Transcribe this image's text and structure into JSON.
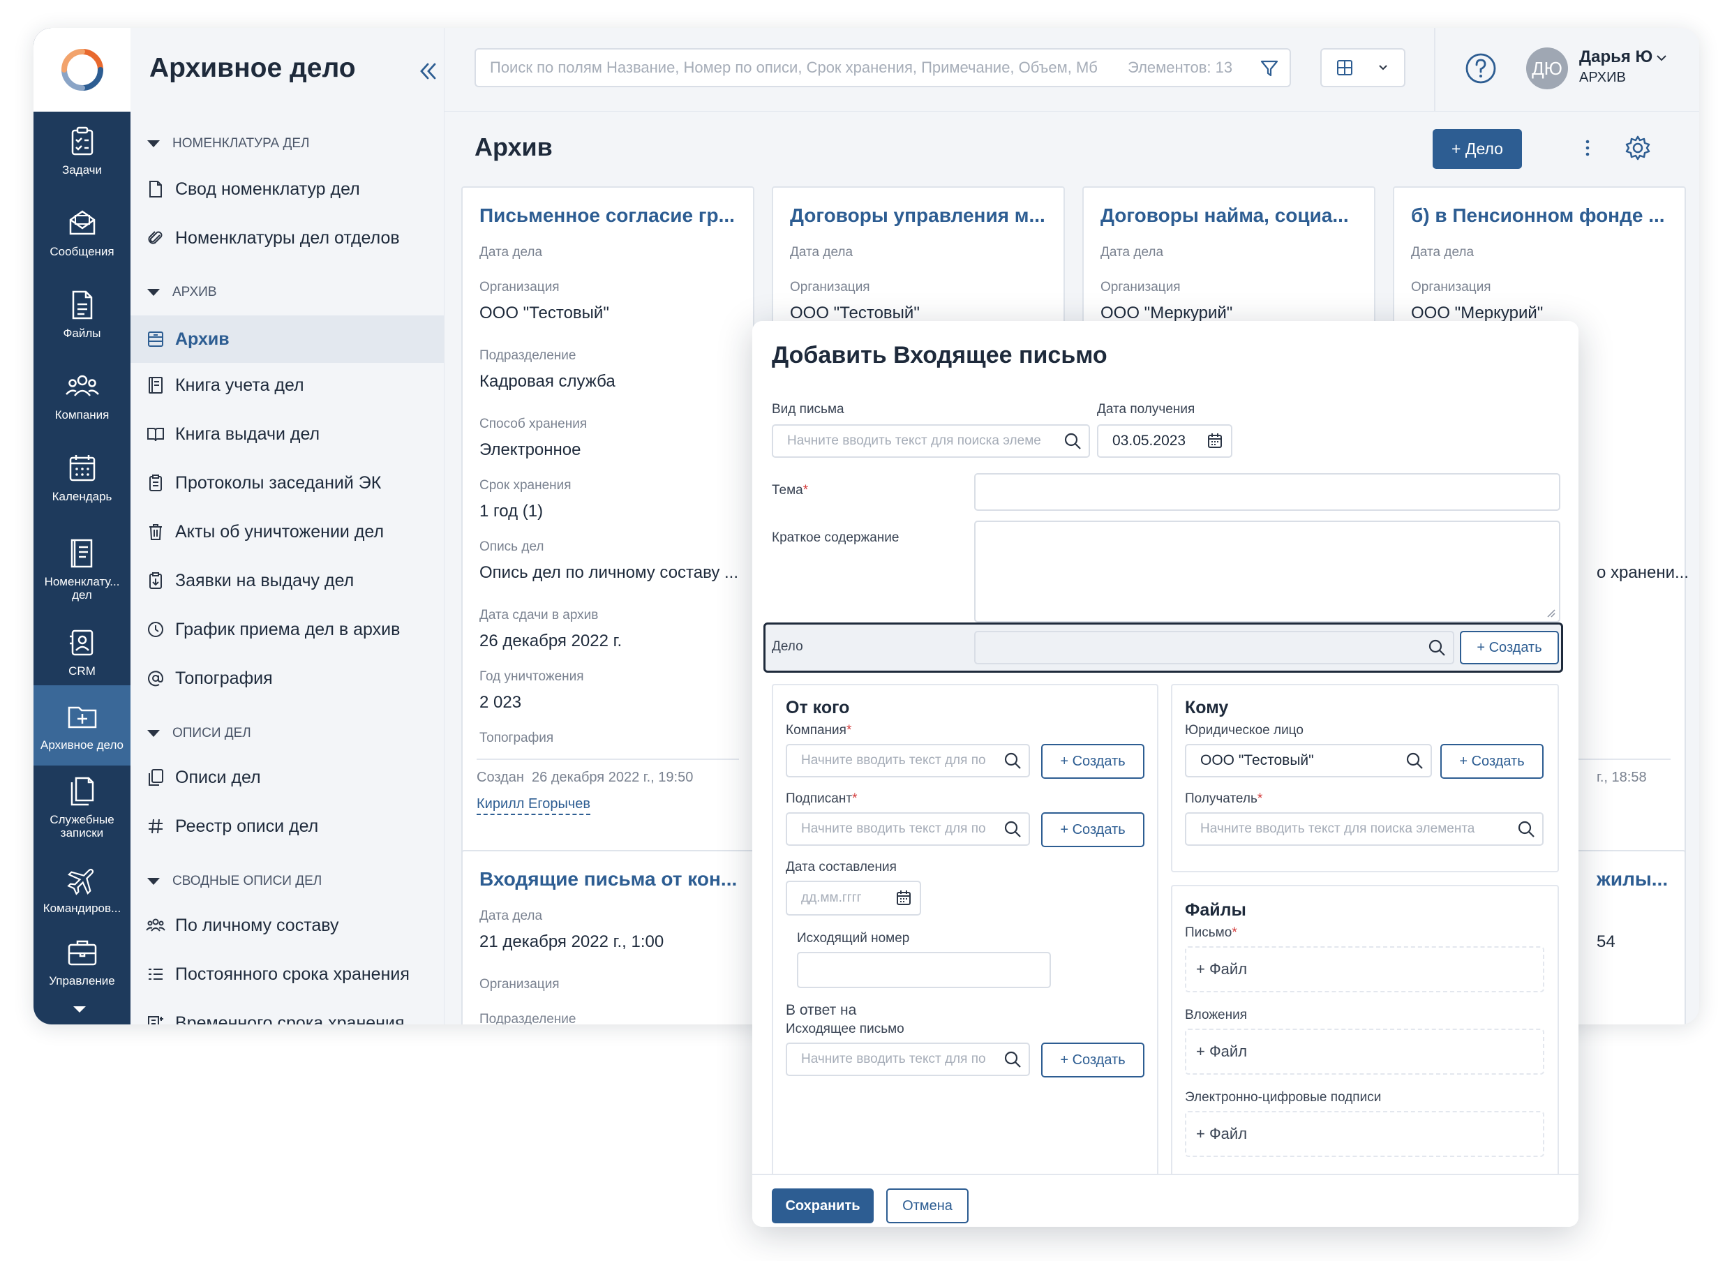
{
  "app": {
    "title": "Архивное дело"
  },
  "colors": {
    "rail": "#1e3a5c",
    "rail_active": "#3a6898",
    "accent": "#2d5d92",
    "required": "#d33a3a"
  },
  "rail": [
    {
      "label": "Задачи",
      "icon": "tasks-icon"
    },
    {
      "label": "Сообщения",
      "icon": "messages-icon"
    },
    {
      "label": "Файлы",
      "icon": "files-icon"
    },
    {
      "label": "Компания",
      "icon": "company-icon"
    },
    {
      "label": "Календарь",
      "icon": "calendar-icon"
    },
    {
      "label": "Номенклату... дел",
      "icon": "nomenclature-icon"
    },
    {
      "label": "CRM",
      "icon": "crm-icon"
    },
    {
      "label": "Архивное дело",
      "icon": "archive-folder-icon",
      "active": true
    },
    {
      "label": "Служебные записки",
      "icon": "memos-icon"
    },
    {
      "label": "Командиров...",
      "icon": "travel-icon"
    },
    {
      "label": "Управление",
      "icon": "management-icon"
    }
  ],
  "sidebar": {
    "sections": [
      {
        "title": "НОМЕНКЛАТУРА ДЕЛ"
      },
      {
        "title": "АРХИВ"
      },
      {
        "title": "ОПИСИ ДЕЛ"
      },
      {
        "title": "СВОДНЫЕ ОПИСИ ДЕЛ"
      }
    ],
    "items": [
      {
        "label": "Свод номенклатур дел",
        "icon": "document-icon"
      },
      {
        "label": "Номенклатуры дел отделов",
        "icon": "paperclip-icon"
      },
      {
        "label": "Архив",
        "icon": "archive-icon",
        "active": true
      },
      {
        "label": "Книга учета дел",
        "icon": "ledger-icon"
      },
      {
        "label": "Книга выдачи дел",
        "icon": "open-book-icon"
      },
      {
        "label": "Протоколы заседаний ЭК",
        "icon": "clipboard-icon"
      },
      {
        "label": "Акты об уничтожении дел",
        "icon": "trash-icon"
      },
      {
        "label": "Заявки на выдачу дел",
        "icon": "request-icon"
      },
      {
        "label": "График приема дел в архив",
        "icon": "clock-icon"
      },
      {
        "label": "Топография",
        "icon": "at-icon"
      },
      {
        "label": "Описи дел",
        "icon": "copy-icon"
      },
      {
        "label": "Реестр описи дел",
        "icon": "hash-icon"
      },
      {
        "label": "По личному составу",
        "icon": "people-icon"
      },
      {
        "label": "Постоянного срока хранения",
        "icon": "list-icon"
      },
      {
        "label": "Временного срока хранения",
        "icon": "temp-list-icon"
      }
    ]
  },
  "topbar": {
    "search_placeholder": "Поиск по полям Название, Номер по описи, Срок хранения, Примечание, Объем, Мб",
    "count_text": "Элементов: 13",
    "user_initials": "ДЮ",
    "user_name": "Дарья Ю",
    "user_role": "АРХИВ"
  },
  "page": {
    "title": "Архив",
    "add_button": "+ Дело"
  },
  "cards": [
    {
      "title": "Письменное согласие гр...",
      "fields": [
        {
          "label": "Дата дела",
          "value": ""
        },
        {
          "label": "Организация",
          "value": "ООО \"Тестовый\""
        },
        {
          "label": "Подразделение",
          "value": "Кадровая служба"
        },
        {
          "label": "Способ хранения",
          "value": "Электронное"
        },
        {
          "label": "Срок хранения",
          "value": "1 год (1)"
        },
        {
          "label": "Опись дел",
          "value": "Опись дел по личному составу ..."
        },
        {
          "label": "Дата сдачи в архив",
          "value": "26 декабря 2022 г."
        },
        {
          "label": "Год уничтожения",
          "value": "2 023"
        },
        {
          "label": "Топография",
          "value": ""
        }
      ],
      "created_label": "Создан",
      "created_at": "26 декабря 2022 г., 19:50",
      "author": "Кирилл Егорычев"
    },
    {
      "title": "Договоры управления м...",
      "date_label": "Дата дела",
      "org_label": "Организация",
      "org_value": "ООО \"Тестовый\""
    },
    {
      "title": "Договоры найма, социа...",
      "date_label": "Дата дела",
      "org_label": "Организация",
      "org_value": "ООО \"Меркурий\""
    },
    {
      "title": "б) в Пенсионном фонде ...",
      "date_label": "Дата дела",
      "org_label": "Организация",
      "org_value": "ООО \"Меркурий\"",
      "peek_text": "о хранени...",
      "peek_time": "г., 18:58"
    },
    {
      "title": "Входящие письма от кон...",
      "date_label": "Дата дела",
      "date_value": "21 декабря 2022 г., 1:00",
      "org_label": "Организация",
      "dept_label": "Подразделение"
    },
    {
      "title_peek": "жилы...",
      "value_peek": "54"
    }
  ],
  "modal": {
    "title": "Добавить Входящее письмо",
    "letter_type_label": "Вид письма",
    "letter_type_placeholder": "Начните вводить текст для поиска элеме",
    "received_label": "Дата получения",
    "received_value": "03.05.2023",
    "subject_label": "Тема",
    "summary_label": "Краткое содержание",
    "case_label": "Дело",
    "create_label": "+ Создать",
    "from": {
      "title": "От кого",
      "company_label": "Компания",
      "company_placeholder": "Начните вводить текст для по",
      "signer_label": "Подписант",
      "signer_placeholder": "Начните вводить текст для по",
      "date_label": "Дата составления",
      "date_placeholder": "дд.мм.гггг",
      "outgoing_label": "Исходящий номер",
      "reply_title": "В ответ на",
      "reply_label": "Исходящее письмо",
      "reply_placeholder": "Начните вводить текст для по"
    },
    "to": {
      "title": "Кому",
      "entity_label": "Юридическое лицо",
      "entity_value": "ООО \"Тестовый\"",
      "recipient_label": "Получатель",
      "recipient_placeholder": "Начните вводить текст для поиска элемента"
    },
    "files": {
      "title": "Файлы",
      "letter_label": "Письмо",
      "attachments_label": "Вложения",
      "signatures_label": "Электронно-цифровые подписи",
      "add_file": "+ Файл"
    },
    "save": "Сохранить",
    "cancel": "Отмена"
  }
}
